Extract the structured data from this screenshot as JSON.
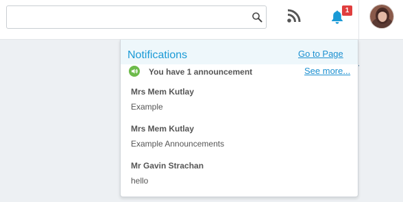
{
  "topbar": {
    "search": {
      "value": "",
      "placeholder": ""
    },
    "icons": {
      "search": "search-icon",
      "feed": "rss-icon",
      "notifications": "bell-icon",
      "avatar": "user-avatar"
    },
    "notification_count": "1",
    "colors": {
      "feed": "#555555",
      "bell": "#1a9ad6",
      "badge": "#e03e3e"
    }
  },
  "notifications": {
    "title": "Notifications",
    "go_to_page": "Go to Page",
    "see_more": "See more...",
    "announcement": {
      "icon": "speaker-icon",
      "text": "You have 1 announcement"
    },
    "items": [
      {
        "sender": "Mrs Mem Kutlay",
        "message": "Example"
      },
      {
        "sender": "Mrs Mem Kutlay",
        "message": "Example Announcements"
      },
      {
        "sender": "Mr Gavin Strachan",
        "message": "hello"
      }
    ],
    "colors": {
      "title": "#1a9ad6",
      "link": "#1a8fd0",
      "header_bg": "#eef7fb",
      "announce_icon": "#6dbb4b"
    }
  }
}
